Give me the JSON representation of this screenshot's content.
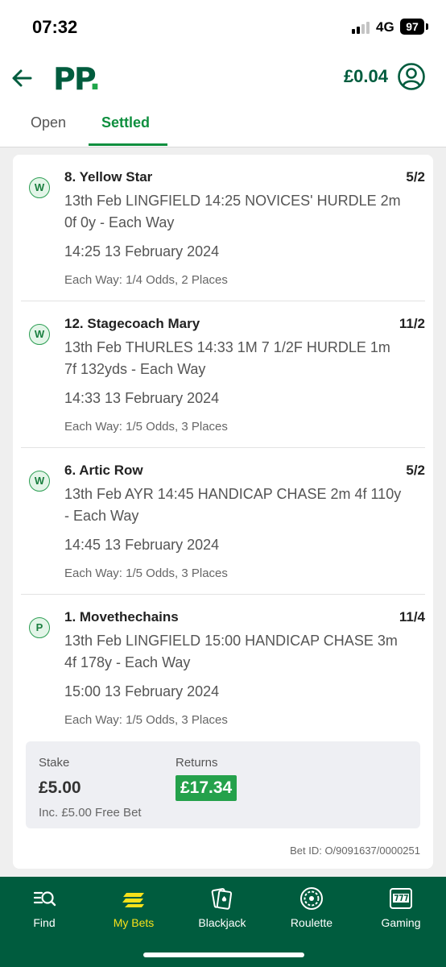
{
  "status_bar": {
    "time": "07:32",
    "network": "4G",
    "battery": "97"
  },
  "header": {
    "logo": "PP",
    "logo_dot": ".",
    "balance": "£0.04"
  },
  "tabs": [
    {
      "label": "Open",
      "active": false
    },
    {
      "label": "Settled",
      "active": true
    }
  ],
  "selections": [
    {
      "result": "W",
      "runner": "8. Yellow Star",
      "odds": "5/2",
      "race": "13th Feb LINGFIELD 14:25 NOVICES' HURDLE 2m 0f 0y - Each Way",
      "time": "14:25 13 February 2024",
      "each_way": "Each Way: 1/4 Odds, 2 Places"
    },
    {
      "result": "W",
      "runner": "12. Stagecoach Mary",
      "odds": "11/2",
      "race": "13th Feb THURLES 14:33 1M 7 1/2F HURDLE 1m 7f 132yds - Each Way",
      "time": "14:33 13 February 2024",
      "each_way": "Each Way: 1/5 Odds, 3 Places"
    },
    {
      "result": "W",
      "runner": "6. Artic Row",
      "odds": "5/2",
      "race": "13th Feb AYR 14:45 HANDICAP CHASE 2m 4f 110y - Each Way",
      "time": "14:45 13 February 2024",
      "each_way": "Each Way: 1/5 Odds, 3 Places"
    },
    {
      "result": "P",
      "runner": "1. Movethechains",
      "odds": "11/4",
      "race": "13th Feb LINGFIELD 15:00 HANDICAP CHASE 3m 4f 178y - Each Way",
      "time": "15:00 13 February 2024",
      "each_way": "Each Way: 1/5 Odds, 3 Places"
    }
  ],
  "bet_summary": {
    "stake_label": "Stake",
    "stake": "£5.00",
    "free_bet": "Inc. £5.00 Free Bet",
    "returns_label": "Returns",
    "returns": "£17.34",
    "bet_id": "Bet ID: O/9091637/0000251"
  },
  "bottom_nav": [
    {
      "label": "Find",
      "icon": "find-icon",
      "active": false
    },
    {
      "label": "My Bets",
      "icon": "my-bets-icon",
      "active": true
    },
    {
      "label": "Blackjack",
      "icon": "cards-icon",
      "active": false
    },
    {
      "label": "Roulette",
      "icon": "roulette-icon",
      "active": false
    },
    {
      "label": "Gaming",
      "icon": "slot-machine-icon",
      "active": false
    }
  ],
  "colors": {
    "brand": "#005c3e",
    "accent": "#0f8f3f",
    "returns_bg": "#24a14b",
    "active_nav": "#f7e11a"
  }
}
